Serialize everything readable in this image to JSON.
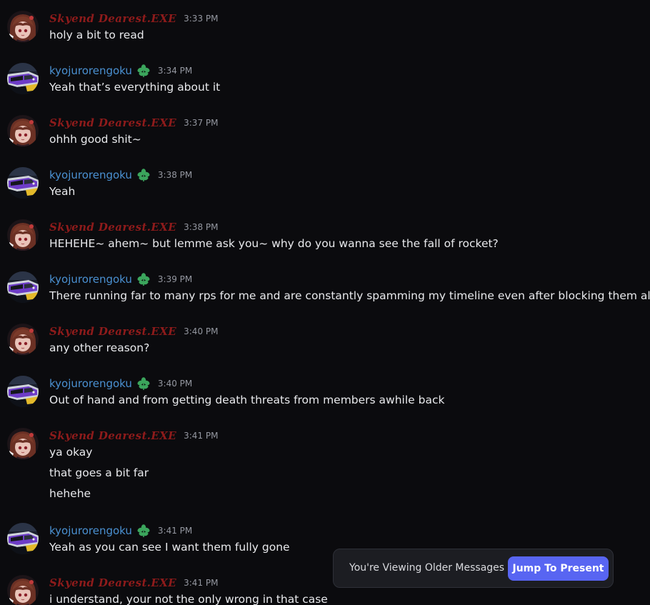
{
  "users": {
    "a": {
      "name": "Skyend Dearest.EXE",
      "avatar": "girl-avatar"
    },
    "b": {
      "name": "kyojurorengoku",
      "avatar": "train-avatar",
      "badge_icon": "leaf-badge-icon"
    }
  },
  "messages": [
    {
      "author": "a",
      "time": "3:33 PM",
      "lines": [
        "holy a bit to read"
      ]
    },
    {
      "author": "b",
      "time": "3:34 PM",
      "lines": [
        "Yeah that’s everything about it"
      ]
    },
    {
      "author": "a",
      "time": "3:37 PM",
      "lines": [
        "ohhh good shit~"
      ]
    },
    {
      "author": "b",
      "time": "3:38 PM",
      "lines": [
        "Yeah"
      ]
    },
    {
      "author": "a",
      "time": "3:38 PM",
      "lines": [
        "HEHEHE~ ahem~ but lemme ask you~ why do you wanna see the fall of rocket?"
      ]
    },
    {
      "author": "b",
      "time": "3:39 PM",
      "lines": [
        "There running far to many rps for me and are constantly spamming my timeline even after blocking them all"
      ]
    },
    {
      "author": "a",
      "time": "3:40 PM",
      "lines": [
        "any other reason?"
      ]
    },
    {
      "author": "b",
      "time": "3:40 PM",
      "lines": [
        "Out of hand and from getting death threats from members awhile back"
      ]
    },
    {
      "author": "a",
      "time": "3:41 PM",
      "lines": [
        "ya okay",
        "that goes a bit far",
        "hehehe"
      ]
    },
    {
      "author": "b",
      "time": "3:41 PM",
      "lines": [
        "Yeah as you can see I want them fully gone"
      ]
    },
    {
      "author": "a",
      "time": "3:41 PM",
      "lines": [
        "i understand, your not the only wrong in that case"
      ]
    }
  ],
  "jump_bar": {
    "text": "You're Viewing Older Messages",
    "button_label": "Jump To Present"
  },
  "colors": {
    "background": "#0b0b0e",
    "name_a": "#8e1b1b",
    "name_b": "#4a90d1",
    "badge": "#3ba55c",
    "accent": "#5865f2"
  }
}
